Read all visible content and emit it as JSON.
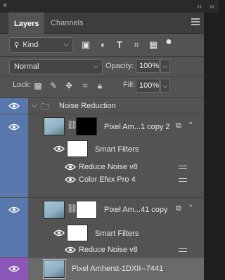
{
  "window": {
    "close_glyph": "×",
    "collapse_glyph": "‹‹",
    "expand_glyph": "‹‹"
  },
  "tabs": [
    {
      "label": "Layers",
      "active": true
    },
    {
      "label": "Channels",
      "active": false
    }
  ],
  "filter": {
    "kind_label": "Kind",
    "icons": [
      "image-filter-icon",
      "adjustment-filter-icon",
      "type-filter-icon",
      "shape-filter-icon",
      "smart-object-filter-icon",
      "filter-toggle-icon"
    ]
  },
  "blend": {
    "mode": "Normal",
    "opacity_label": "Opacity:",
    "opacity_value": "100%"
  },
  "lock": {
    "label": "Lock:",
    "fill_label": "Fill:",
    "fill_value": "100%"
  },
  "layers": {
    "group": {
      "name": "Noise Reduction"
    },
    "layer1": {
      "name": "Pixel Am...1 copy 2",
      "smart_filters_label": "Smart Filters",
      "filters": [
        "Reduce Noise v8",
        "Color Efex Pro 4"
      ]
    },
    "layer2": {
      "name": "Pixel Am...41 copy",
      "smart_filters_label": "Smart Filters",
      "filters": [
        "Reduce Noise v8"
      ]
    },
    "base": {
      "name": "Pixel Amherst-1DXII--7441"
    }
  },
  "colors": {
    "group_blue": "#5878ad",
    "base_purple": "#8a56b7",
    "panel_bg": "#535353"
  }
}
